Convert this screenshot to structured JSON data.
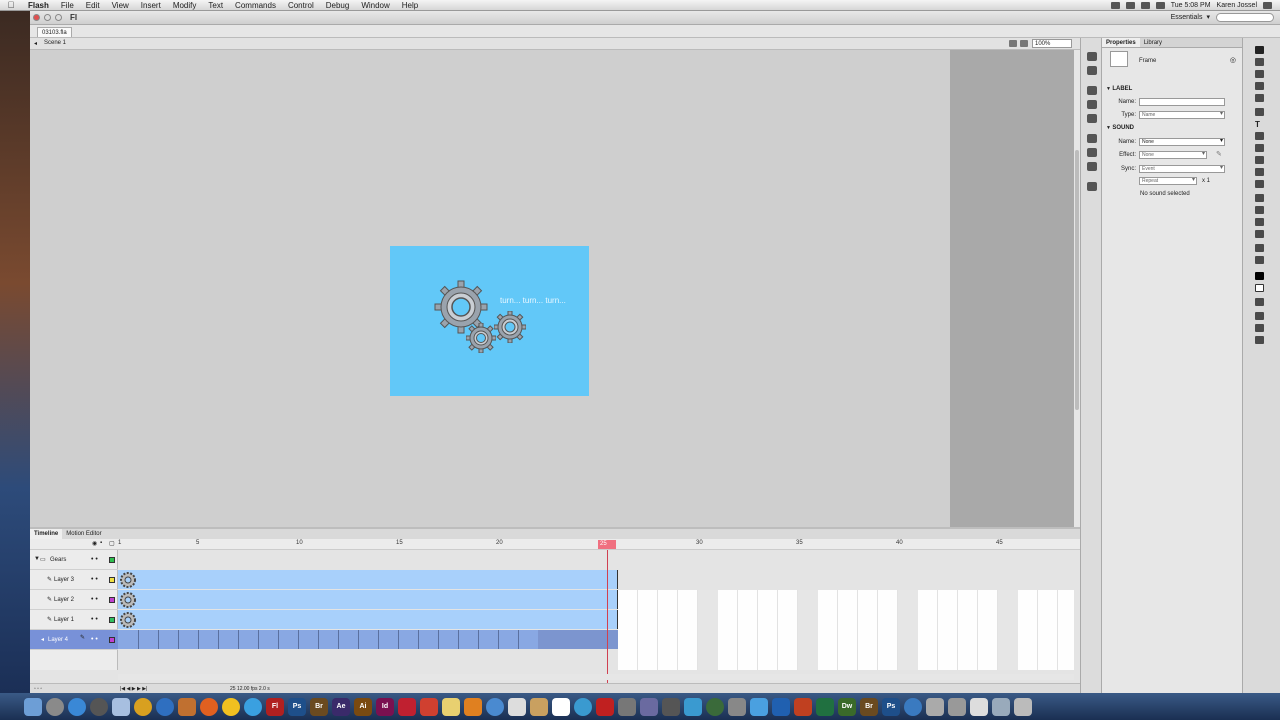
{
  "menubar": {
    "apple": "",
    "items": [
      "Flash",
      "File",
      "Edit",
      "View",
      "Insert",
      "Modify",
      "Text",
      "Commands",
      "Control",
      "Debug",
      "Window",
      "Help"
    ],
    "clock": "Tue 5:08 PM",
    "user": "Karen Jossel"
  },
  "window": {
    "app_logo": "Fl",
    "workspace": "Essentials",
    "doc_tab": "03103.fla",
    "scene": "Scene 1",
    "zoom": "100%"
  },
  "stage": {
    "background": "#62c8f8",
    "text": "turn... turn... turn..."
  },
  "timeline": {
    "tabs": [
      "Timeline",
      "Motion Editor"
    ],
    "frame_numbers": [
      "1",
      "5",
      "10",
      "15",
      "20",
      "25",
      "30",
      "35",
      "40",
      "45"
    ],
    "current_frame": "25",
    "layers": [
      {
        "name": "Gears",
        "type": "folder",
        "color": "#2fbf4f"
      },
      {
        "name": "Layer 3",
        "type": "layer",
        "color": "#f0e040"
      },
      {
        "name": "Layer 2",
        "type": "layer",
        "color": "#c040d0"
      },
      {
        "name": "Layer 1",
        "type": "layer",
        "color": "#30c060"
      },
      {
        "name": "Layer 4",
        "type": "layer",
        "color": "#c040d0",
        "selected": true
      }
    ],
    "footer": "25   12.00 fps   2.0 s"
  },
  "properties": {
    "tabs": [
      "Properties",
      "Library"
    ],
    "type": "Frame",
    "label_section": "LABEL",
    "name_label": "Name:",
    "name_value": "",
    "type_label": "Type:",
    "type_value": "Name",
    "sound_section": "SOUND",
    "sound_name_label": "Name:",
    "sound_name_value": "None",
    "effect_label": "Effect:",
    "effect_value": "None",
    "sync_label": "Sync:",
    "sync_value": "Event",
    "repeat_value": "Repeat",
    "repeat_count": "x  1",
    "status": "No sound selected"
  },
  "dock": {
    "apps": [
      "Finder",
      "Safari",
      "Firefox",
      "Chrome",
      "Fl",
      "Ps",
      "Br",
      "Ae",
      "Ai",
      "Id",
      "Cc",
      "Acrobat",
      "Mail",
      "Calendar",
      "Dw",
      "Br",
      "Ps"
    ]
  }
}
